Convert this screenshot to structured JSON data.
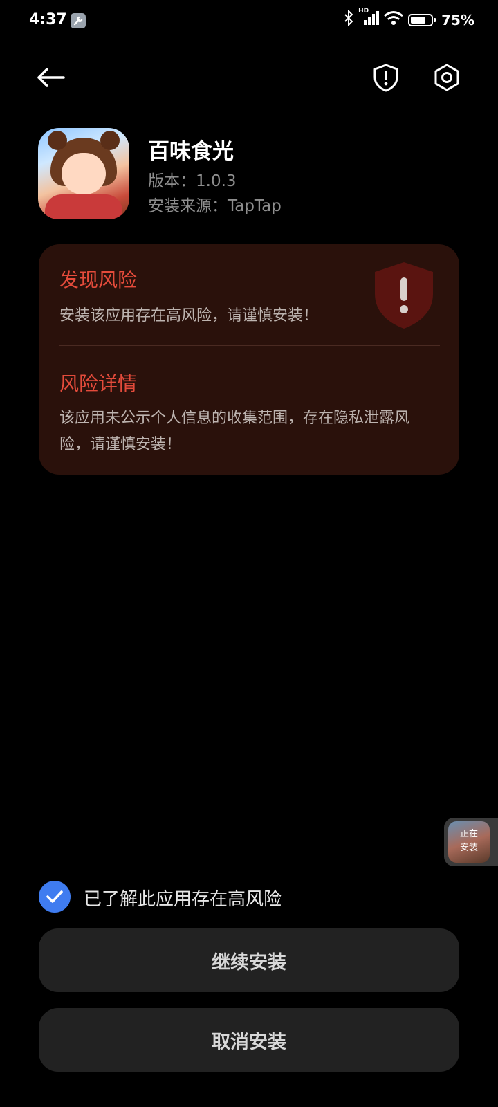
{
  "status_bar": {
    "time": "4:37",
    "tool_icon": "wrench-icon",
    "network_label": "HD",
    "battery_percent": "75%",
    "battery_level": 0.75
  },
  "toolbar": {
    "back_icon": "arrow-left-icon",
    "shield_icon": "shield-exclamation-icon",
    "settings_icon": "gear-icon"
  },
  "app": {
    "name": "百味食光",
    "version": "版本：1.0.3",
    "source": "安装来源：TapTap"
  },
  "risk_card": {
    "title": "发现风险",
    "message": "安装该应用存在高风险，请谨慎安装！",
    "detail_title": "风险详情",
    "detail_message": "该应用未公示个人信息的收集范围，存在隐私泄露风险，请谨慎安装！",
    "accent_color": "#e44b3b",
    "background_color": "#2a110b"
  },
  "floating_badge": {
    "label": "正在\n安装"
  },
  "consent": {
    "checked": true,
    "label": "已了解此应用存在高风险",
    "color": "#3f7cf0"
  },
  "buttons": {
    "continue_label": "继续安装",
    "cancel_label": "取消安装"
  }
}
